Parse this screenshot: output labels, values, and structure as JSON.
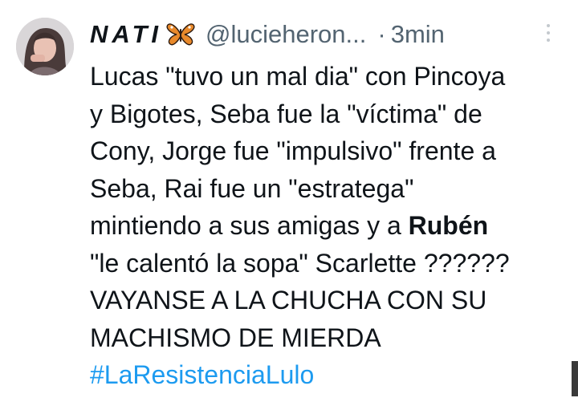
{
  "tweet": {
    "display_name": "NATI",
    "handle": "@lucieheron...",
    "separator": "·",
    "time": "3min",
    "lines": [
      "Lucas \"tuvo un mal dia\" con Pincoya",
      "y Bigotes, Seba fue la \"víctima\" de",
      "Cony, Jorge fue \"impulsivo\" frente a",
      "Seba, Rai fue un \"estratega\""
    ],
    "line5_prefix": "mintiendo a sus amigas y a ",
    "line5_bold": "Rubén",
    "line6": "\"le calentó la sopa\" Scarlette ??????",
    "line7": "VAYANSE A LA CHUCHA CON SU",
    "line8": "MACHISMO DE MIERDA",
    "hashtag": "#LaResistenciaLulo"
  },
  "icons": {
    "avatar": "avatar",
    "name_emoji": "butterfly-icon",
    "more": "more-options-icon"
  },
  "colors": {
    "text": "#0f1419",
    "secondary": "#536471",
    "link": "#1d9bf0",
    "background": "#ffffff"
  }
}
